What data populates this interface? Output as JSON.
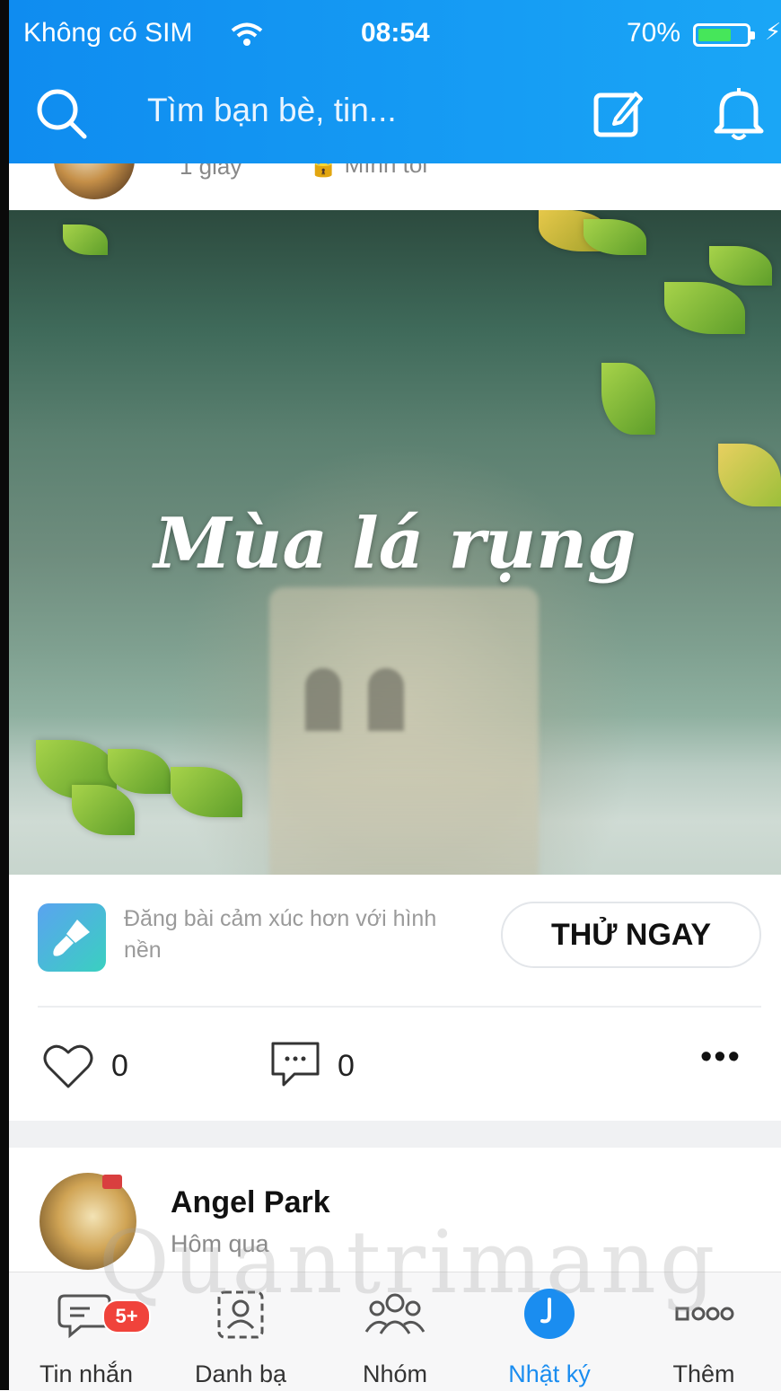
{
  "status_bar": {
    "carrier": "Không có SIM",
    "time": "08:54",
    "battery_percent": "70%",
    "battery_level": 0.7,
    "battery_color": "#46e65a"
  },
  "header": {
    "search_placeholder": "Tìm bạn bè, tin...",
    "accent_color": "#1aa6f6",
    "icons": [
      "search-icon",
      "compose-icon",
      "bell-icon"
    ]
  },
  "previous_post": {
    "time": "1 giây",
    "privacy": "Mình tôi"
  },
  "banner": {
    "title": "Mùa lá rụng"
  },
  "promo": {
    "text": "Đăng bài cảm xúc hơn với hình nền",
    "button_label": "THỬ NGAY"
  },
  "actions": {
    "likes": "0",
    "comments": "0",
    "more": "•••"
  },
  "post": {
    "author": "Angel Park",
    "time": "Hôm qua"
  },
  "tabbar": {
    "active_color": "#1a8df0",
    "badge_color": "#f0433b",
    "tabs": [
      {
        "label": "Tin nhắn",
        "icon": "message-icon",
        "badge": "5+"
      },
      {
        "label": "Danh bạ",
        "icon": "contacts-icon"
      },
      {
        "label": "Nhóm",
        "icon": "group-icon"
      },
      {
        "label": "Nhật ký",
        "icon": "timeline-icon",
        "active": true
      },
      {
        "label": "Thêm",
        "icon": "more-grid-icon"
      }
    ]
  }
}
